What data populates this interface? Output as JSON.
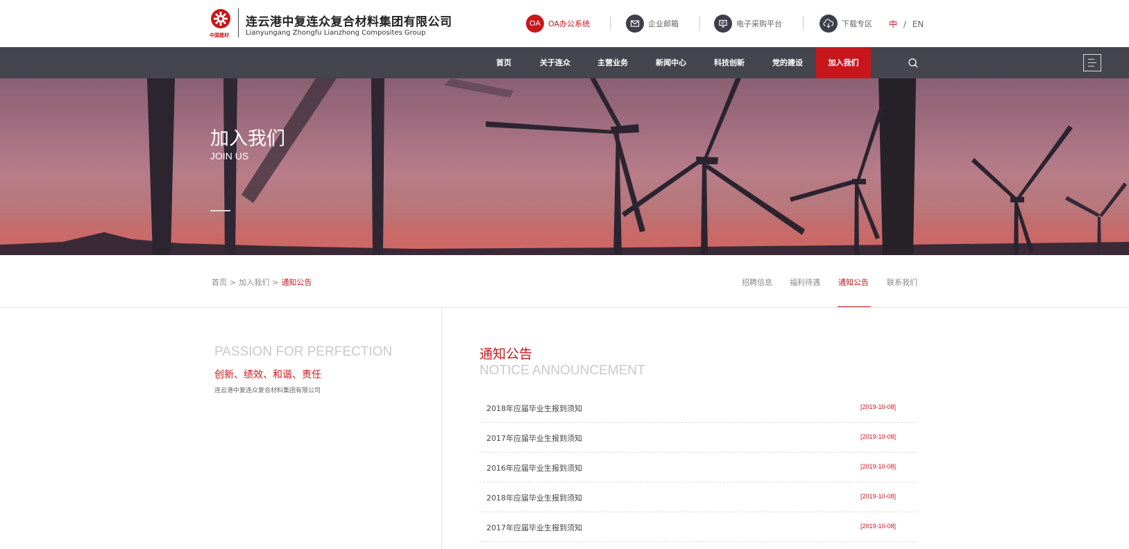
{
  "header": {
    "company_cn": "连云港中复连众复合材料集团有限公司",
    "company_en": "Lianyungang  Zhongfu Lianzhong  Composites Group",
    "logo_sub": "中国建材",
    "tools": [
      {
        "icon": "oa-icon",
        "icon_text": "OA",
        "label": "OA办公系统"
      },
      {
        "icon": "mail-icon",
        "label": "企业邮箱"
      },
      {
        "icon": "procurement-icon",
        "label": "电子采购平台"
      },
      {
        "icon": "cloud-download-icon",
        "label": "下载专区"
      }
    ],
    "lang": {
      "zh": "中",
      "sep": "/",
      "en": "EN"
    }
  },
  "nav": {
    "items": [
      "首页",
      "关于连众",
      "主营业务",
      "新闻中心",
      "科技创新",
      "党的建设",
      "加入我们"
    ],
    "active": "加入我们"
  },
  "banner": {
    "title": "加入我们",
    "subtitle": "JOIN US"
  },
  "breadcrumb": [
    "首页",
    "加入我们",
    "通知公告"
  ],
  "breadcrumb_sep": ">",
  "subtabs": [
    "招聘信息",
    "福利待遇",
    "通知公告",
    "联系我们"
  ],
  "subtab_active": "通知公告",
  "left": {
    "slogan_en": "PASSION FOR PERFECTION",
    "values": "创新、绩效、和谐、责任",
    "company": "连云港中复连众复合材料集团有限公司"
  },
  "section": {
    "title": "通知公告",
    "subtitle": "NOTICE ANNOUNCEMENT"
  },
  "notices": [
    {
      "title": "2018年应届毕业生报到须知",
      "date": "[2019-10-08]"
    },
    {
      "title": "2017年应届毕业生报到须知",
      "date": "[2019-10-08]"
    },
    {
      "title": "2016年应届毕业生报到须知",
      "date": "[2019-10-08]"
    },
    {
      "title": "2018年应届毕业生报到须知",
      "date": "[2019-10-08]"
    },
    {
      "title": "2017年应届毕业生报到须知",
      "date": "[2019-10-08]"
    }
  ],
  "colors": {
    "brand_red": "#c8161d",
    "nav_bg": "#45454f"
  }
}
